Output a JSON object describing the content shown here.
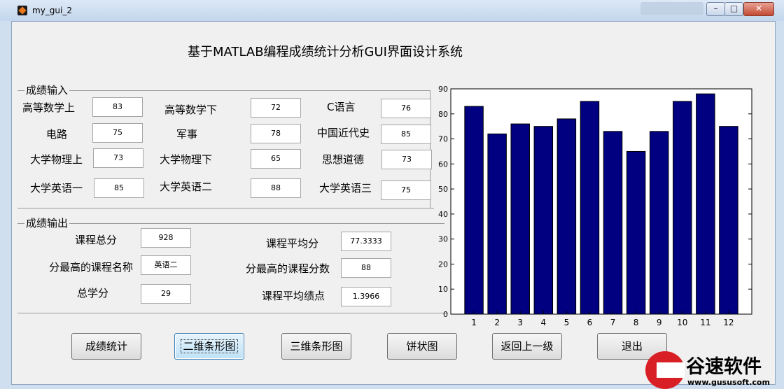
{
  "window": {
    "title": "my_gui_2",
    "buttons": {
      "minimize": "–",
      "maximize": "□",
      "close": "✕"
    }
  },
  "main_title": "基于MATLAB编程成绩统计分析GUI界面设计系统",
  "input_panel": {
    "title": "成绩输入",
    "courses": [
      {
        "label": "高等数学上",
        "value": "83"
      },
      {
        "label": "高等数学下",
        "value": "72"
      },
      {
        "label": "C语言",
        "value": "76"
      },
      {
        "label": "电路",
        "value": "75"
      },
      {
        "label": "军事",
        "value": "78"
      },
      {
        "label": "中国近代史",
        "value": "85"
      },
      {
        "label": "大学物理上",
        "value": "73"
      },
      {
        "label": "大学物理下",
        "value": "65"
      },
      {
        "label": "思想道德",
        "value": "73"
      },
      {
        "label": "大学英语一",
        "value": "85"
      },
      {
        "label": "大学英语二",
        "value": "88"
      },
      {
        "label": "大学英语三",
        "value": "75"
      }
    ]
  },
  "output_panel": {
    "title": "成绩输出",
    "total_label": "课程总分",
    "total_value": "928",
    "avg_label": "课程平均分",
    "avg_value": "77.3333",
    "max_name_label": "分最高的课程名称",
    "max_name_value": "英语二",
    "max_score_label": "分最高的课程分数",
    "max_score_value": "88",
    "credits_label": "总学分",
    "credits_value": "29",
    "gpa_label": "课程平均绩点",
    "gpa_value": "1.3966"
  },
  "buttons": {
    "stats": "成绩统计",
    "bar2d": "二维条形图",
    "bar3d": "三维条形图",
    "pie": "饼状图",
    "back": "返回上一级",
    "exit": "退出"
  },
  "watermark": {
    "brand": "谷速软件",
    "url": "www.gususoft.com"
  },
  "chart_data": {
    "type": "bar",
    "categories": [
      "1",
      "2",
      "3",
      "4",
      "5",
      "6",
      "7",
      "8",
      "9",
      "10",
      "11",
      "12"
    ],
    "values": [
      83,
      72,
      76,
      75,
      78,
      85,
      73,
      65,
      73,
      85,
      88,
      75
    ],
    "ylim": [
      0,
      90
    ],
    "yticks": [
      0,
      10,
      20,
      30,
      40,
      50,
      60,
      70,
      80,
      90
    ],
    "bar_color": "#000080",
    "title": "",
    "xlabel": "",
    "ylabel": ""
  }
}
